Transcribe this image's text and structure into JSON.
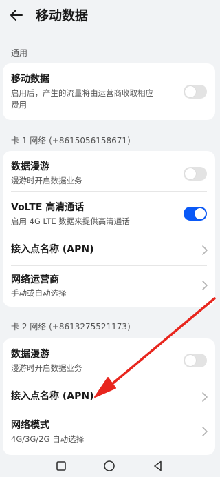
{
  "header": {
    "title": "移动数据"
  },
  "general": {
    "section_label": "通用",
    "mobile_data": {
      "title": "移动数据",
      "description_line1": "启用后，产生的流量将由运营商收取相应",
      "description_line2": "费用",
      "enabled": false
    }
  },
  "sim1": {
    "section_label": "卡 1 网络 (+8615056158671)",
    "roaming": {
      "title": "数据漫游",
      "description": "漫游时开启数据业务",
      "enabled": false
    },
    "volte": {
      "title": "VoLTE 高清通话",
      "description": "启用 4G LTE 数据来提供高清通话",
      "enabled": true
    },
    "apn": {
      "title": "接入点名称 (APN)"
    },
    "carrier": {
      "title": "网络运营商",
      "description": "手动或自动选择"
    }
  },
  "sim2": {
    "section_label": "卡 2 网络 (+8613275521173)",
    "roaming": {
      "title": "数据漫游",
      "description": "漫游时开启数据业务",
      "enabled": false
    },
    "apn": {
      "title": "接入点名称 (APN)"
    },
    "network_mode": {
      "title": "网络模式",
      "description": "4G/3G/2G 自动选择"
    }
  },
  "colors": {
    "accent": "#0a59f7",
    "annotation": "#e8261e",
    "background": "#f1f3f5"
  },
  "icons": {
    "back": "arrow-left-icon",
    "chevron": "chevron-right-icon",
    "nav_back": "triangle-back-icon",
    "nav_home": "circle-home-icon",
    "nav_recent": "square-recent-icon"
  }
}
